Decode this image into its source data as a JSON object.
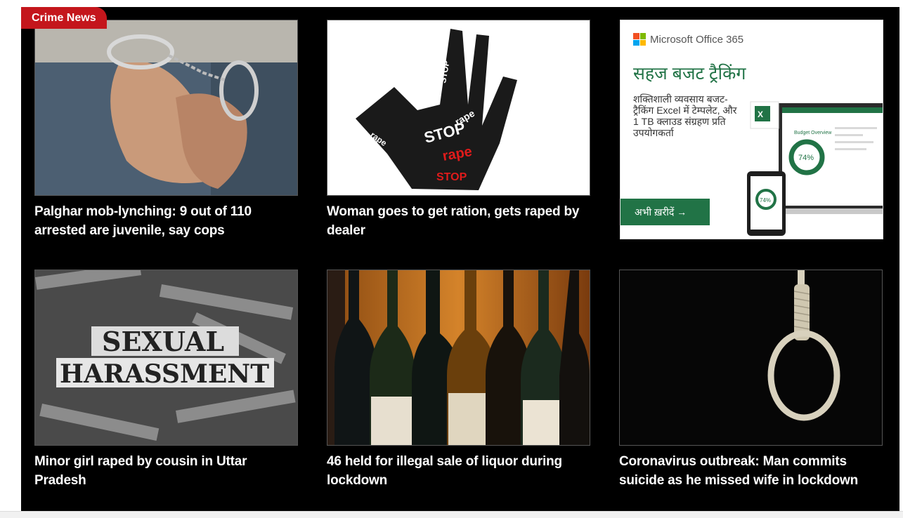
{
  "section": {
    "label": "Crime News"
  },
  "articles": [
    {
      "title": "Palghar mob-lynching: 9 out of 110 arrested are juvenile, say cops"
    },
    {
      "title": "Woman goes to get ration, gets raped by dealer"
    },
    {
      "title": "Minor girl raped by cousin in Uttar Pradesh"
    },
    {
      "title": "46 held for illegal sale of liquor during lockdown"
    },
    {
      "title": "Coronavirus outbreak: Man commits suicide as he missed wife in lockdown"
    }
  ],
  "ad": {
    "brand": "Microsoft Office 365",
    "heading": "सहज बजट ट्रैकिंग",
    "body": "शक्तिशाली व्यवसाय बजट-ट्रैकिंग Excel में टेम्पलेट, और 1 TB क्लाउड संग्रहण प्रति उपयोगकर्ता",
    "cta": "अभी ख़रीदें →",
    "screen_title": "Budget Overview",
    "percent": "74%",
    "colors": {
      "excel_green": "#217346",
      "ms_red": "#f25022",
      "ms_green": "#7fba00",
      "ms_blue": "#00a4ef",
      "ms_yellow": "#ffb900"
    }
  },
  "thumb_texts": {
    "stop": "STOP",
    "rape": "rape",
    "sexual": "SEXUAL",
    "harassment": "HARASSMENT"
  },
  "colors": {
    "tag_red": "#c4161c",
    "background": "#000000"
  }
}
